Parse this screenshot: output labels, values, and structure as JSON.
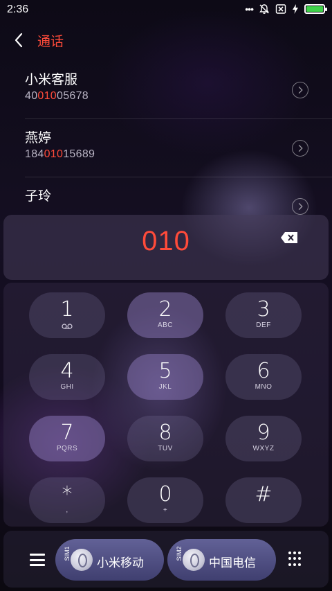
{
  "status_bar": {
    "time": "2:36",
    "icons": [
      "more-dots-icon",
      "mute-bell-icon",
      "no-sim-icon",
      "charging-icon",
      "battery-icon"
    ],
    "battery_color": "#3fd24a"
  },
  "header": {
    "title": "通话"
  },
  "contacts": [
    {
      "name": "小米客服",
      "number_prefix": "40",
      "number_match": "010",
      "number_suffix": "05678"
    },
    {
      "name": "燕婷",
      "number_prefix": "184",
      "number_match": "010",
      "number_suffix": "15689"
    },
    {
      "name": "子玲",
      "number_prefix": "",
      "number_match": "",
      "number_suffix": ""
    }
  ],
  "display": {
    "digits": "010"
  },
  "keypad": [
    {
      "num": "1",
      "sub": ""
    },
    {
      "num": "2",
      "sub": "ABC"
    },
    {
      "num": "3",
      "sub": "DEF"
    },
    {
      "num": "4",
      "sub": "GHI"
    },
    {
      "num": "5",
      "sub": "JKL"
    },
    {
      "num": "6",
      "sub": "MNO"
    },
    {
      "num": "7",
      "sub": "PQRS"
    },
    {
      "num": "8",
      "sub": "TUV"
    },
    {
      "num": "9",
      "sub": "WXYZ"
    },
    {
      "num": "*",
      "sub": ","
    },
    {
      "num": "0",
      "sub": "+"
    },
    {
      "num": "#",
      "sub": ""
    }
  ],
  "bottom_bar": {
    "sim1": {
      "tag": "SIM1",
      "label": "小米移动"
    },
    "sim2": {
      "tag": "SIM2",
      "label": "中国电信"
    }
  },
  "colors": {
    "accent": "#ff4b3a"
  }
}
